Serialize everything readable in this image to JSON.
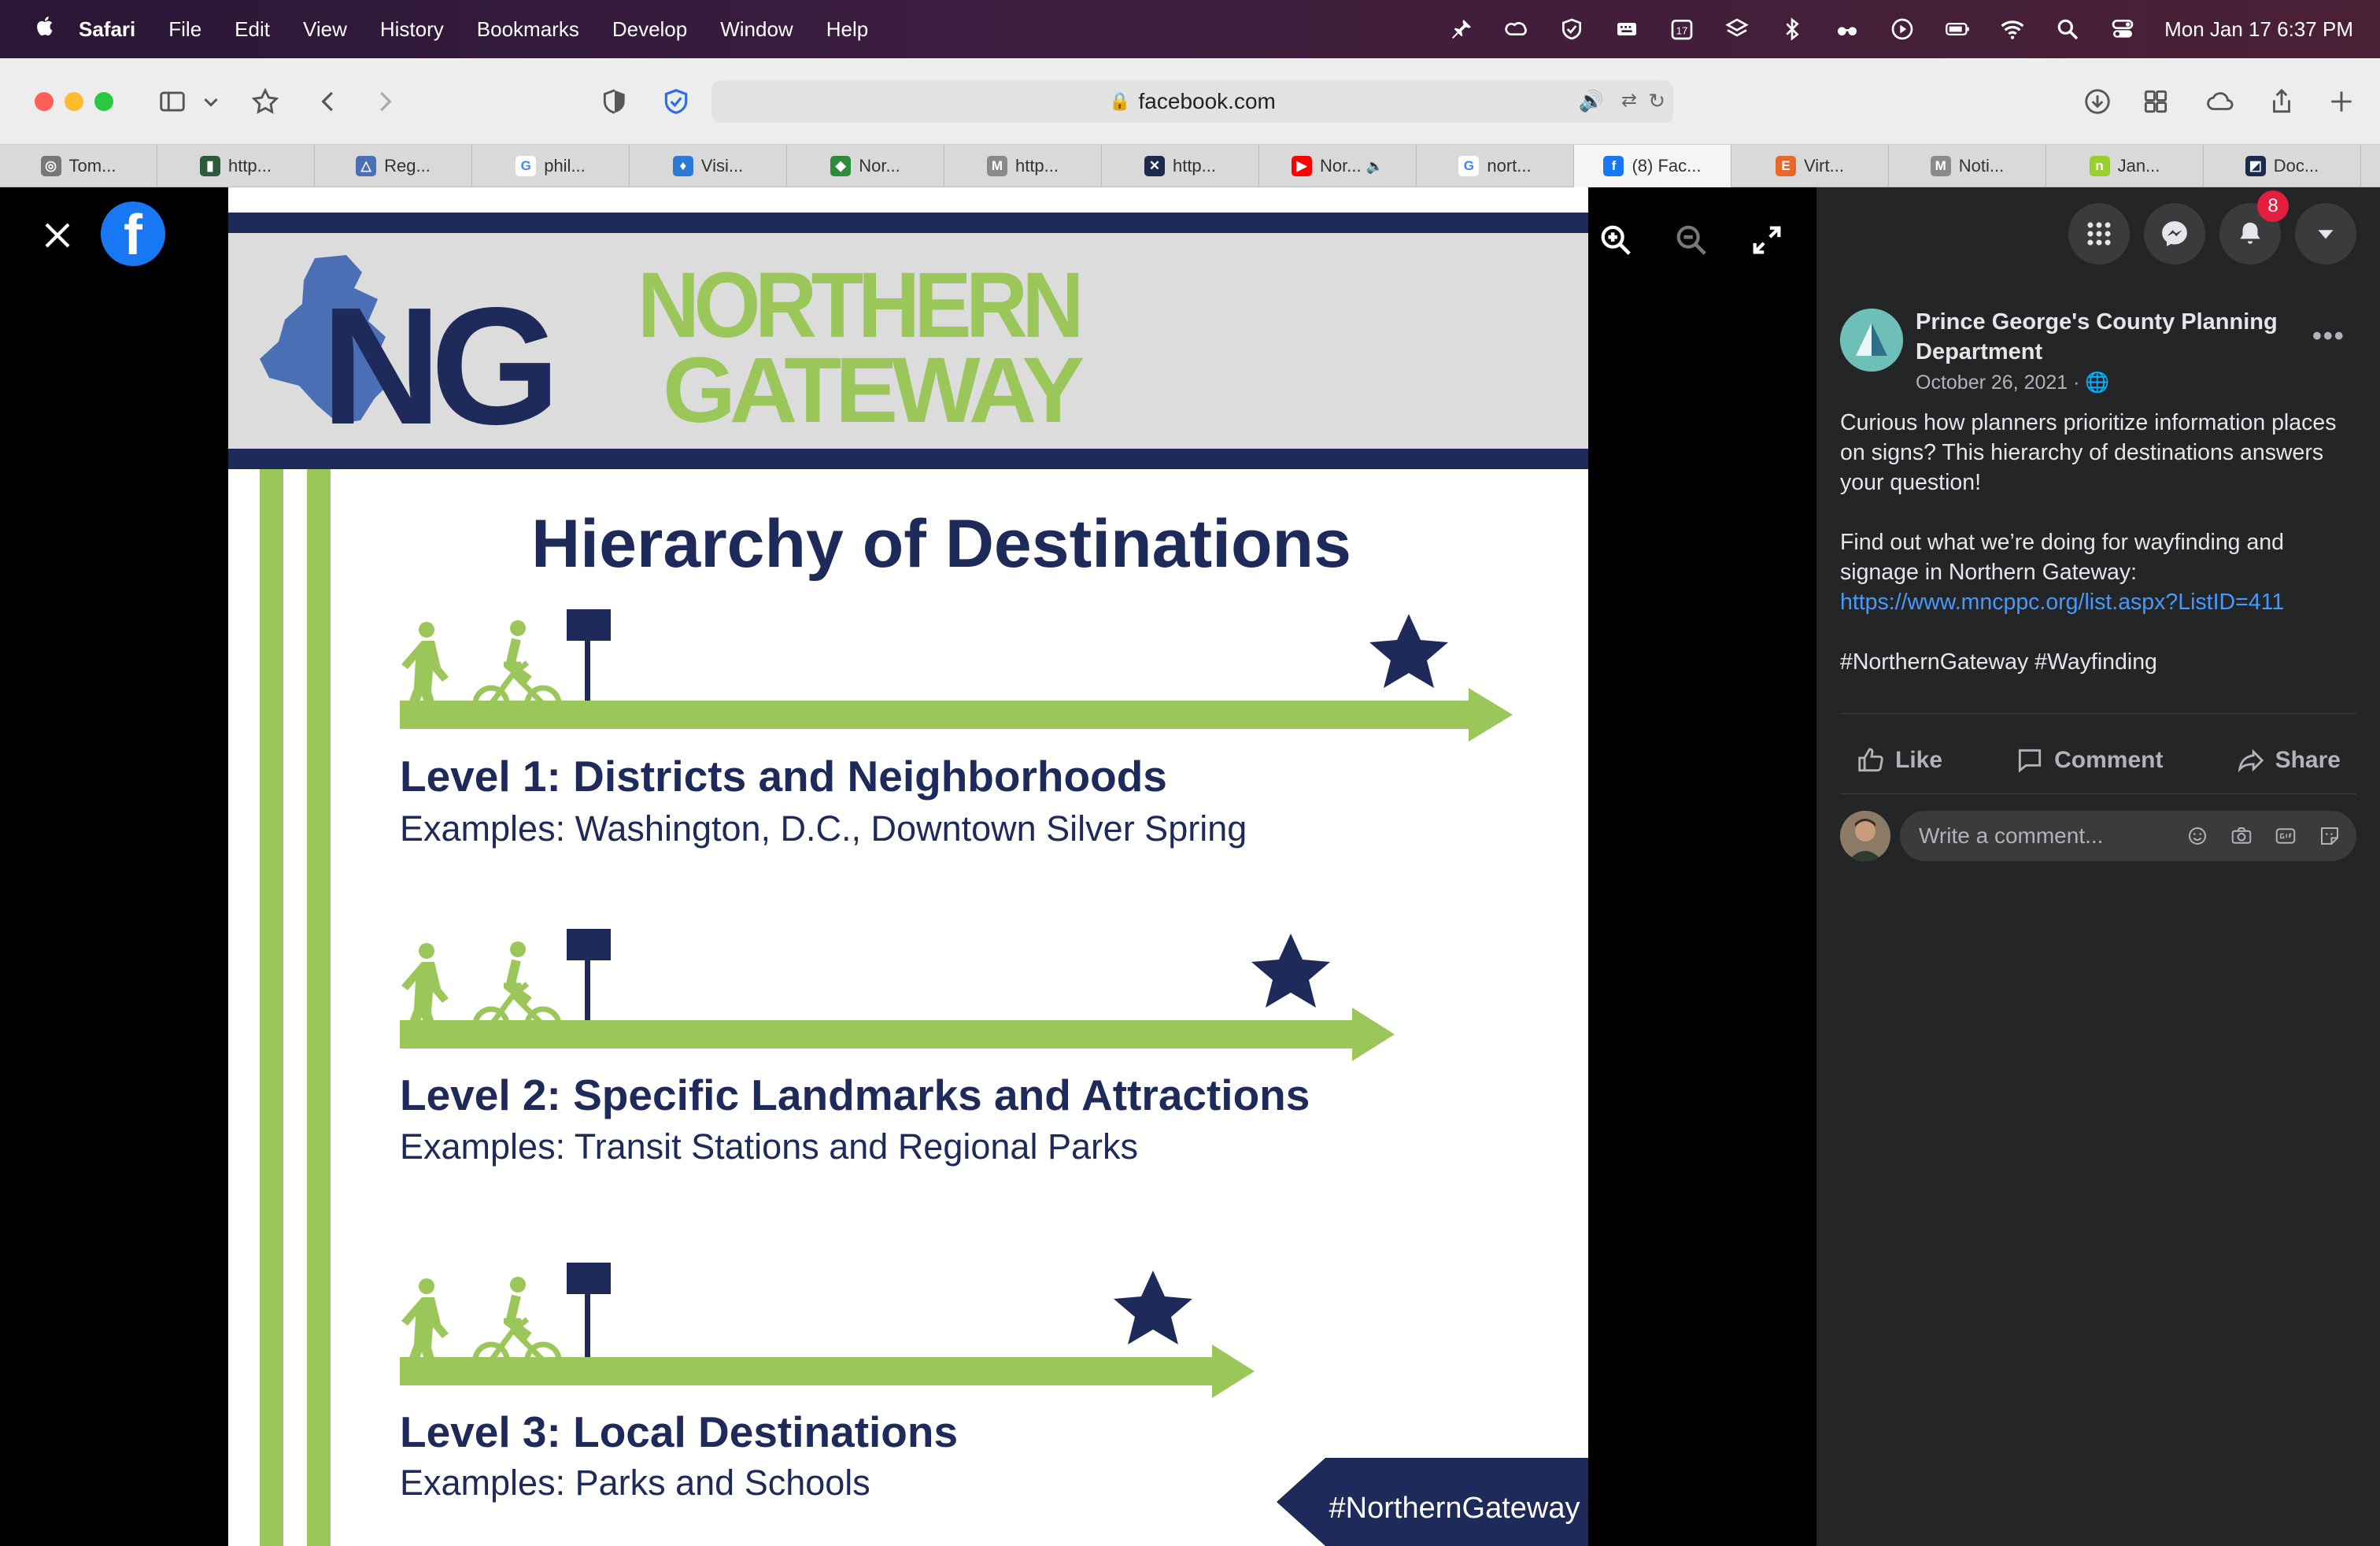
{
  "menubar": {
    "app": "Safari",
    "items": [
      "File",
      "Edit",
      "View",
      "History",
      "Bookmarks",
      "Develop",
      "Window",
      "Help"
    ],
    "calendar_day": "17",
    "clock": "Mon Jan 17  6:37 PM"
  },
  "toolbar": {
    "url": "facebook.com"
  },
  "tabs": [
    {
      "label": "Tom...",
      "fav_color": "#777777",
      "fav": "◎"
    },
    {
      "label": "http...",
      "fav_color": "#2b5b3a",
      "fav": "▮"
    },
    {
      "label": "Reg...",
      "fav_color": "#4a6fb5",
      "fav": "△"
    },
    {
      "label": "phil...",
      "fav_color": "#ffffff",
      "fav": "G"
    },
    {
      "label": "Visi...",
      "fav_color": "#2b7bd6",
      "fav": "♦"
    },
    {
      "label": "Nor...",
      "fav_color": "#2e8b3a",
      "fav": "◆"
    },
    {
      "label": "http...",
      "fav_color": "#8a8a8a",
      "fav": "M"
    },
    {
      "label": "http...",
      "fav_color": "#1d2a4e",
      "fav": "✕"
    },
    {
      "label": "Nor...",
      "fav_color": "#ff0000",
      "fav": "▶"
    },
    {
      "label": "nort...",
      "fav_color": "#ffffff",
      "fav": "G"
    },
    {
      "label": "(8) Fac...",
      "fav_color": "#1877f2",
      "fav": "f"
    },
    {
      "label": "Virt...",
      "fav_color": "#e8682a",
      "fav": "E"
    },
    {
      "label": "Noti...",
      "fav_color": "#8a8a8a",
      "fav": "M"
    },
    {
      "label": "Jan...",
      "fav_color": "#9acd32",
      "fav": "n"
    },
    {
      "label": "Doc...",
      "fav_color": "#1d2a4e",
      "fav": "◩"
    }
  ],
  "viewer": {
    "fb_letter": "f"
  },
  "graphic": {
    "logo_letters": "NG",
    "logo_line1": "NORTHERN",
    "logo_line2": "GATEWAY",
    "title": "Hierarchy of Destinations",
    "levels": [
      {
        "heading": "Level 1: Districts and Neighborhoods",
        "examples": "Examples: Washington, D.C., Downtown Silver Spring"
      },
      {
        "heading": "Level 2: Specific Landmarks and Attractions",
        "examples": "Examples: Transit Stations and Regional Parks"
      },
      {
        "heading": "Level 3: Local Destinations",
        "examples": "Examples: Parks and Schools"
      }
    ],
    "hashtag": "#NorthernGateway",
    "colors": {
      "navy": "#1d2a5a",
      "green": "#9bc75a",
      "gray": "#dcdcdc"
    }
  },
  "post": {
    "page_name": "Prince George's County Planning Department",
    "date": "October 26, 2021 ·",
    "para1": "Curious how planners prioritize information places on signs? This hierarchy of destinations answers your question!",
    "para2": "Find out what we’re doing for wayfinding and signage in Northern Gateway:",
    "link": "https://www.mncppc.org/list.aspx?ListID=411",
    "hashtags": "#NorthernGateway #Wayfinding",
    "like": "Like",
    "comment": "Comment",
    "share": "Share",
    "comment_placeholder": "Write a comment...",
    "notif_count": "8"
  }
}
